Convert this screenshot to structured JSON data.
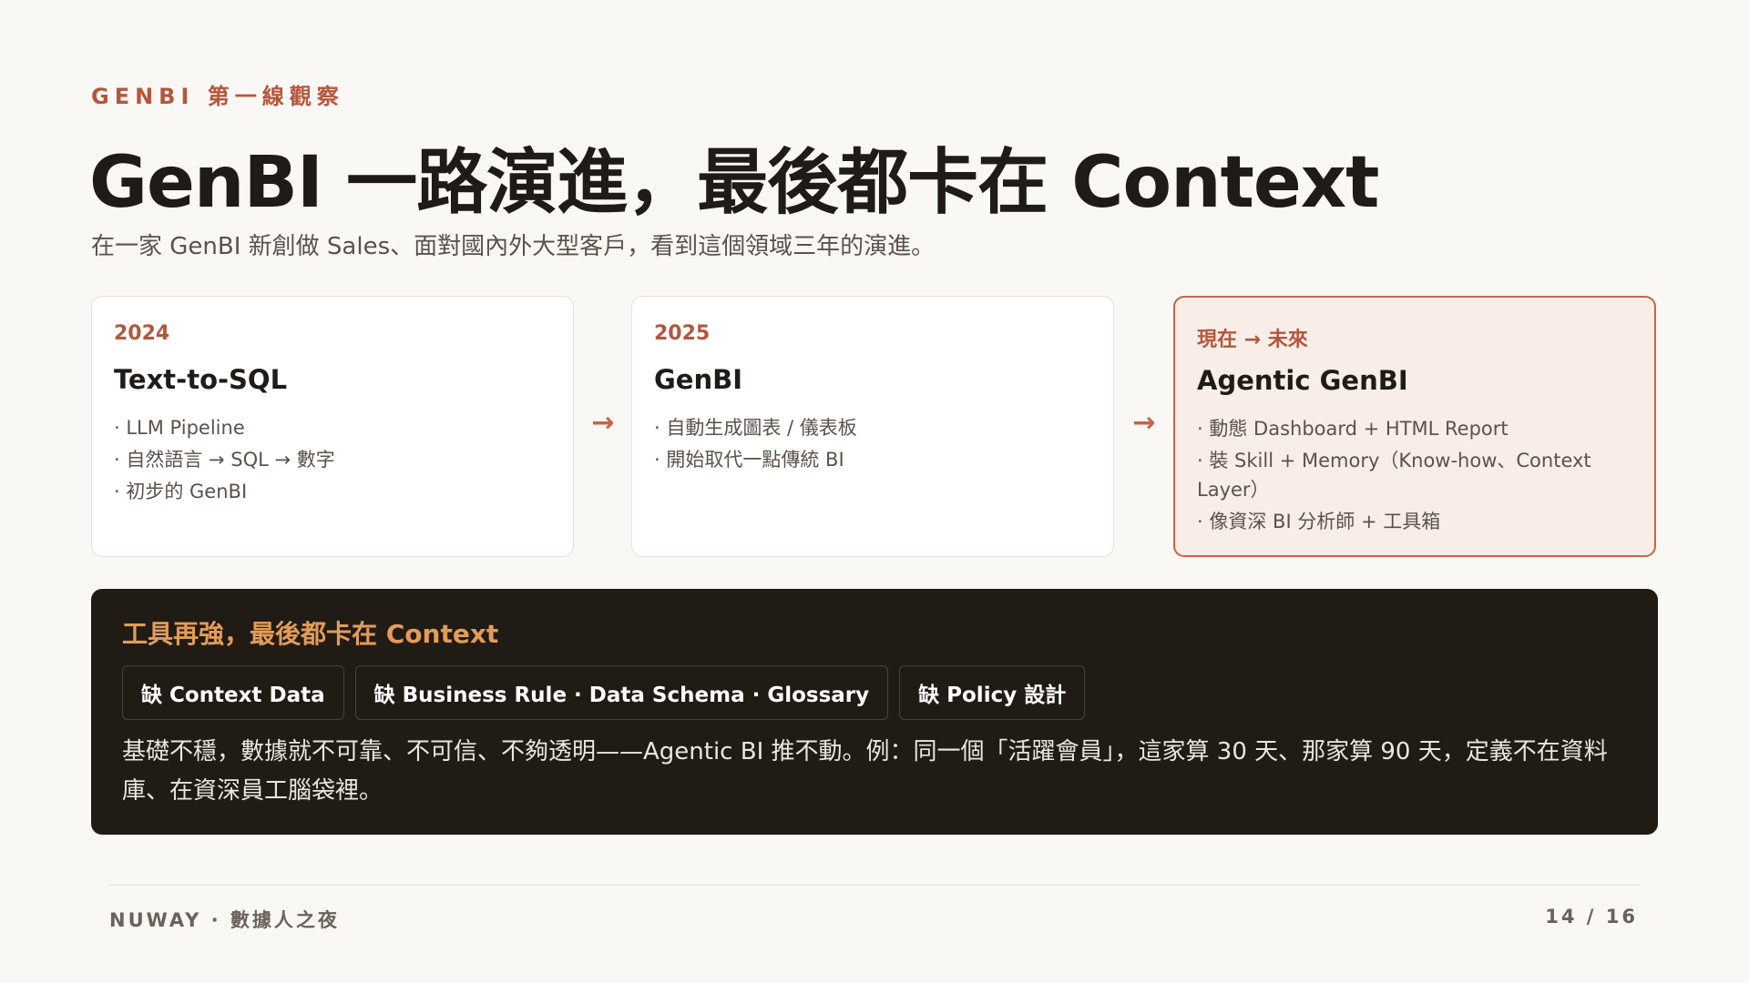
{
  "eyebrow": "GENBI 第一線觀察",
  "title": "GenBI 一路演進，最後都卡在 Context",
  "subtitle": "在一家 GenBI 新創做 Sales、面對國內外大型客戶，看到這個領域三年的演進。",
  "cards": [
    {
      "year": "2024",
      "title": "Text-to-SQL",
      "items": [
        "LLM Pipeline",
        "自然語言 → SQL → 數字",
        "初步的 GenBI"
      ]
    },
    {
      "year": "2025",
      "title": "GenBI",
      "items": [
        "自動生成圖表 / 儀表板",
        "開始取代一點傳統 BI"
      ]
    },
    {
      "year": "現在 → 未來",
      "title": "Agentic GenBI",
      "items": [
        "動態 Dashboard + HTML Report",
        "裝 Skill + Memory（Know-how、Context Layer）",
        "像資深 BI 分析師 + 工具箱"
      ]
    }
  ],
  "arrow": "→",
  "callout": {
    "heading": "工具再強，最後都卡在 Context",
    "chips": [
      "缺 Context Data",
      "缺 Business Rule · Data Schema · Glossary",
      "缺 Policy 設計"
    ],
    "body": "基礎不穩，數據就不可靠、不可信、不夠透明——Agentic BI 推不動。例：同一個「活躍會員」，這家算 30 天、那家算 90 天，定義不在資料庫、在資深員工腦袋裡。"
  },
  "footer": {
    "left": "NUWAY · 數據人之夜",
    "page": "14 / 16"
  },
  "colors": {
    "accent": "#b5563c",
    "callout_bg": "#211b16",
    "callout_heading": "#e39c57",
    "highlight_card_bg": "#f9ede8",
    "page_bg": "#faf8f4"
  }
}
